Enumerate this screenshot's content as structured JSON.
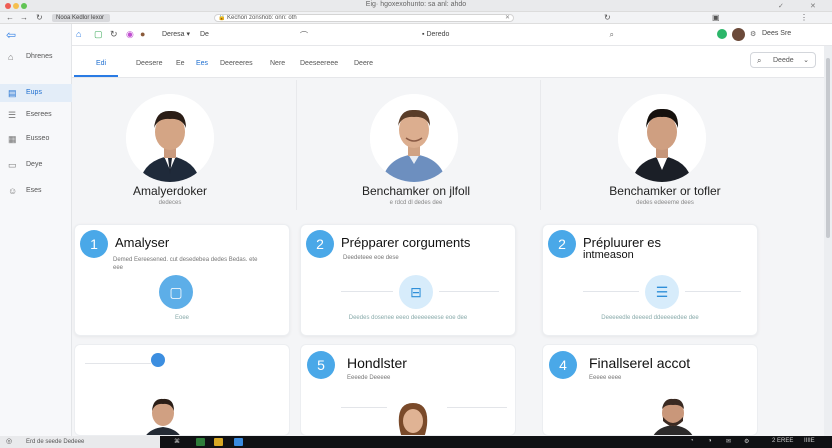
{
  "window": {
    "title": "Eig· hgoxexohunto: sa anl: ahdo",
    "right_icons": [
      "✓",
      "✕"
    ]
  },
  "browser": {
    "tab_label": "Nooa Kedlor lexor",
    "url": "Kechon zonshob: onn: oth",
    "url_close": "✕"
  },
  "sidebar": {
    "back_icon": "arrow-back-icon",
    "items": [
      {
        "label": "Dhrenes",
        "icon": "home-icon"
      },
      {
        "label": "Eups",
        "icon": "document-icon",
        "active": true
      },
      {
        "label": "Eserees",
        "icon": "list-icon"
      },
      {
        "label": "Eusseo",
        "icon": "table-icon"
      },
      {
        "label": "Deye",
        "icon": "calendar-icon"
      },
      {
        "label": "Eses",
        "icon": "people-icon"
      }
    ]
  },
  "appbar": {
    "profile": "Deresa",
    "profile_suffix": "De",
    "search_label": "Deredo",
    "user_name": "Dees Sre"
  },
  "tabs": [
    {
      "label": "Edi",
      "active": true
    },
    {
      "label": "Deesere"
    },
    {
      "label": "Ee"
    },
    {
      "label": "Ees",
      "active_color": true
    },
    {
      "label": "Deereeres"
    },
    {
      "label": "Nere"
    },
    {
      "label": "Deeseereee"
    },
    {
      "label": "Deere"
    }
  ],
  "filter": {
    "label": "Deede"
  },
  "people": [
    {
      "name": "Amalyerdoker",
      "sub": "dedeces"
    },
    {
      "name": "Benchamker on jlfoll",
      "sub": "e rdcd dl dedes dee"
    },
    {
      "name": "Benchamker or tofler",
      "sub": "dedes edeeeme dees"
    }
  ],
  "steps": [
    {
      "num": "1",
      "title": "Amalyser",
      "desc": "Demed Eereesened. cut desedebea dedes Bedas. ete",
      "desc2": "eee",
      "foot": "Eoee"
    },
    {
      "num": "2",
      "title": "Prépparer corguments",
      "desc": "Deedeteee eoe dese",
      "foot": "Deedes dosenee eeeo deeeeeeese eoe dee"
    },
    {
      "num": "2",
      "title": "Prépluurer es",
      "title2": "intmeason",
      "desc": "",
      "foot": "Deeeeedle deeeed ddeeeeedee dee"
    }
  ],
  "lower": [
    {
      "title": "",
      "sub": ""
    },
    {
      "num": "5",
      "title": "Hondlster",
      "sub": "Eeeede Deeeee"
    },
    {
      "num": "4",
      "title": "Finallserel accot",
      "sub": "Eeeee eeee"
    }
  ],
  "status": {
    "text": "Erd de seede Dedeee",
    "tray": "2 EREE",
    "time": "IIIIE"
  },
  "colors": {
    "accent": "#2a7be4",
    "step_badge": "#4aa8e8",
    "sidebar_active_bg": "#e3edf8",
    "online": "#2cb66a"
  }
}
